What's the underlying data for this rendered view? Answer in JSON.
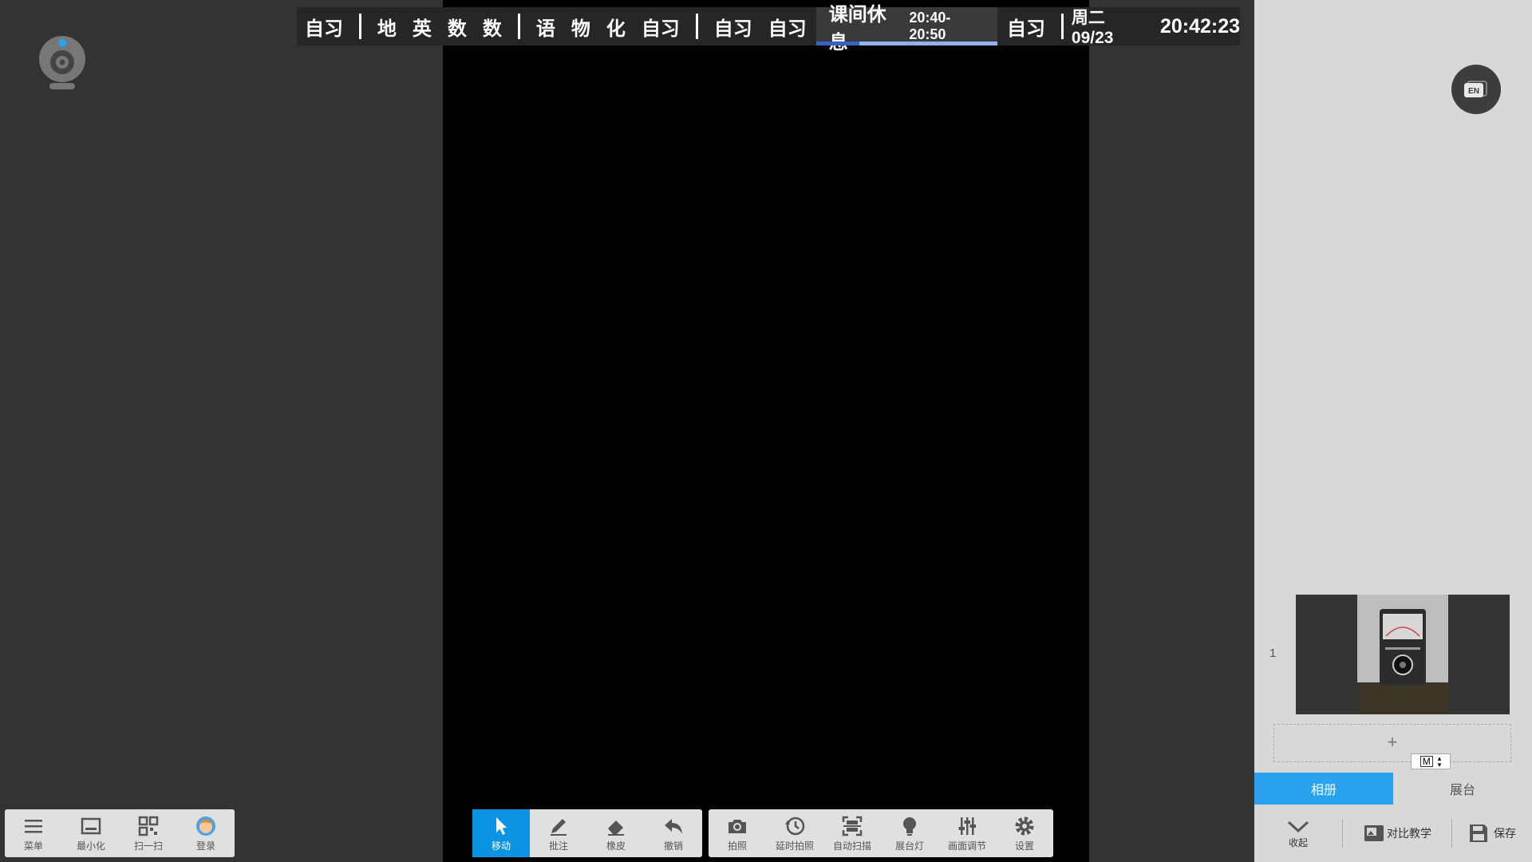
{
  "schedule": {
    "items": [
      "自习",
      "地",
      "英",
      "数",
      "数",
      "语",
      "物",
      "化",
      "自习",
      "自习",
      "自习"
    ],
    "current": {
      "name": "课间休息",
      "time": "20:40-20:50",
      "progress": 0.24
    },
    "after": "自习",
    "date": "周二 09/23",
    "clock": "20:42:23",
    "colors": {
      "progress_done": "#3a5fc8",
      "progress_rest": "#8fb2f0"
    }
  },
  "left_toolbar": [
    {
      "icon": "menu-icon",
      "label": "菜单"
    },
    {
      "icon": "minimize-icon",
      "label": "最小化"
    },
    {
      "icon": "qr-scan-icon",
      "label": "扫一扫"
    },
    {
      "icon": "avatar-icon",
      "label": "登录"
    }
  ],
  "edit_toolbar": [
    {
      "icon": "cursor-icon",
      "label": "移动",
      "active": true
    },
    {
      "icon": "pen-icon",
      "label": "批注"
    },
    {
      "icon": "eraser-icon",
      "label": "橡皮"
    },
    {
      "icon": "undo-icon",
      "label": "撤销"
    }
  ],
  "camera_toolbar": [
    {
      "icon": "camera-icon",
      "label": "拍照"
    },
    {
      "icon": "timer-photo-icon",
      "label": "延时拍照"
    },
    {
      "icon": "auto-scan-icon",
      "label": "自动扫描"
    },
    {
      "icon": "lamp-icon",
      "label": "展台灯"
    },
    {
      "icon": "adjust-icon",
      "label": "画面调节"
    },
    {
      "icon": "settings-icon",
      "label": "设置"
    }
  ],
  "right_panel": {
    "lang_button": "EN",
    "thumbnail_index": "1",
    "add_label": "+",
    "mode_select": "M",
    "tabs": [
      {
        "label": "相册",
        "active": true
      },
      {
        "label": "展台",
        "active": false
      }
    ],
    "bottom": {
      "collapse": "收起",
      "compare": "对比教学",
      "save": "保存"
    },
    "accent_color": "#29a3ef"
  }
}
